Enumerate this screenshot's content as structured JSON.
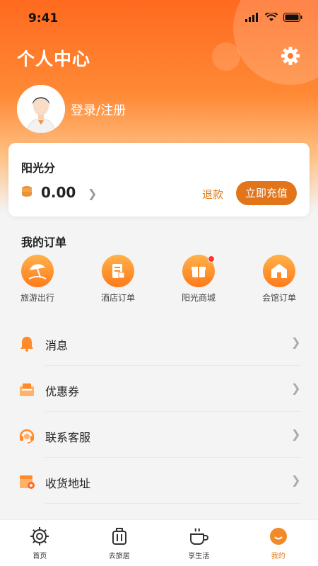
{
  "status_bar": {
    "time": "9:41"
  },
  "header": {
    "title": "个人中心",
    "login_text": "登录/注册"
  },
  "points": {
    "label": "阳光分",
    "amount": "0.00",
    "refund_label": "退款",
    "recharge_label": "立即充值"
  },
  "orders": {
    "title": "我的订单",
    "items": [
      {
        "label": "旅游出行",
        "icon": "beach-umbrella-icon"
      },
      {
        "label": "酒店订单",
        "icon": "document-icon"
      },
      {
        "label": "阳光商城",
        "icon": "gift-box-icon",
        "badge": true
      },
      {
        "label": "会馆订单",
        "icon": "house-icon"
      }
    ]
  },
  "menu": [
    {
      "label": "消息",
      "icon": "bell-icon"
    },
    {
      "label": "优惠券",
      "icon": "coupon-icon"
    },
    {
      "label": "联系客服",
      "icon": "headset-icon"
    },
    {
      "label": "收货地址",
      "icon": "address-icon"
    },
    {
      "label": "",
      "icon": "card-icon"
    }
  ],
  "tabs": [
    {
      "label": "首页",
      "icon": "gear-home-icon"
    },
    {
      "label": "去旅居",
      "icon": "luggage-icon"
    },
    {
      "label": "享生活",
      "icon": "coffee-cup-icon"
    },
    {
      "label": "我的",
      "icon": "smiley-icon",
      "active": true
    }
  ],
  "colors": {
    "accent": "#e2741a",
    "header_start": "#ff6a1f",
    "header_end": "#ffc48a",
    "badge": "#ff3333"
  }
}
